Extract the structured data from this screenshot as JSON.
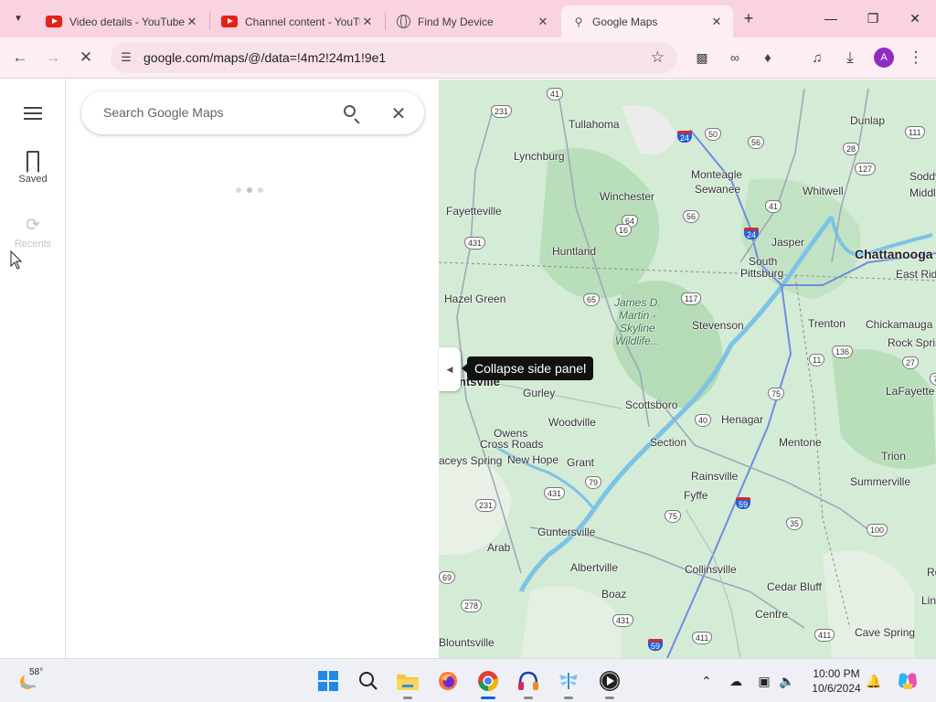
{
  "browser": {
    "tabs": [
      {
        "title": "Video details - YouTube",
        "icon": "youtube-icon",
        "active": false
      },
      {
        "title": "Channel content - YouTube",
        "icon": "youtube-icon",
        "active": false
      },
      {
        "title": "Find My Device",
        "icon": "globe-icon",
        "active": false
      },
      {
        "title": "Google Maps",
        "icon": "maps-icon",
        "active": true
      }
    ],
    "url": "google.com/maps/@/data=!4m2!24m1!9e1",
    "profile_initial": "A"
  },
  "maps": {
    "rail": {
      "saved_label": "Saved",
      "recents_label": "Recents"
    },
    "search": {
      "placeholder": "Search Google Maps"
    },
    "tooltip": "Collapse side panel",
    "places": [
      {
        "name": "Tullahoma"
      },
      {
        "name": "Lynchburg"
      },
      {
        "name": "Monteagle"
      },
      {
        "name": "Sewanee"
      },
      {
        "name": "Winchester"
      },
      {
        "name": "Fayetteville"
      },
      {
        "name": "Whitwell"
      },
      {
        "name": "Dunlap"
      },
      {
        "name": "Soddy-"
      },
      {
        "name": "Middle"
      },
      {
        "name": "Huntland"
      },
      {
        "name": "Jasper"
      },
      {
        "name": "Chattanooga"
      },
      {
        "name": "South"
      },
      {
        "name": "Pittsburg"
      },
      {
        "name": "East Rid"
      },
      {
        "name": "Hazel Green"
      },
      {
        "name": "Stevenson"
      },
      {
        "name": "Trenton"
      },
      {
        "name": "Chickamauga"
      },
      {
        "name": "Rock Spring"
      },
      {
        "name": "ntsville"
      },
      {
        "name": "Gurley"
      },
      {
        "name": "Scottsboro"
      },
      {
        "name": "Henagar"
      },
      {
        "name": "LaFayette"
      },
      {
        "name": "Woodville"
      },
      {
        "name": "Owens"
      },
      {
        "name": "Cross Roads"
      },
      {
        "name": "Section"
      },
      {
        "name": "Mentone"
      },
      {
        "name": "Trion"
      },
      {
        "name": "aceys Spring"
      },
      {
        "name": "New Hope"
      },
      {
        "name": "Grant"
      },
      {
        "name": "Rainsville"
      },
      {
        "name": "Summerville"
      },
      {
        "name": "Fyffe"
      },
      {
        "name": "Guntersville"
      },
      {
        "name": "Arab"
      },
      {
        "name": "Albertville"
      },
      {
        "name": "Collinsville"
      },
      {
        "name": "Cedar Bluff"
      },
      {
        "name": "Boaz"
      },
      {
        "name": "Centre"
      },
      {
        "name": "Lin"
      },
      {
        "name": "Ro"
      },
      {
        "name": "Blountsville"
      },
      {
        "name": "Cave Spring"
      }
    ],
    "park_label": [
      "James D.",
      "Martin -",
      "Skyline",
      "Wildlife..."
    ],
    "routes": [
      "41",
      "231",
      "24",
      "50",
      "56",
      "111",
      "28",
      "127",
      "64",
      "41",
      "56",
      "24",
      "431",
      "16",
      "65",
      "117",
      "136",
      "11",
      "27",
      "72",
      "40",
      "75",
      "431",
      "79",
      "231",
      "59",
      "75",
      "35",
      "100",
      "278",
      "431",
      "411",
      "59",
      "411",
      "69"
    ]
  },
  "taskbar": {
    "weather_temp": "58°",
    "time": "10:00 PM",
    "date": "10/6/2024"
  }
}
